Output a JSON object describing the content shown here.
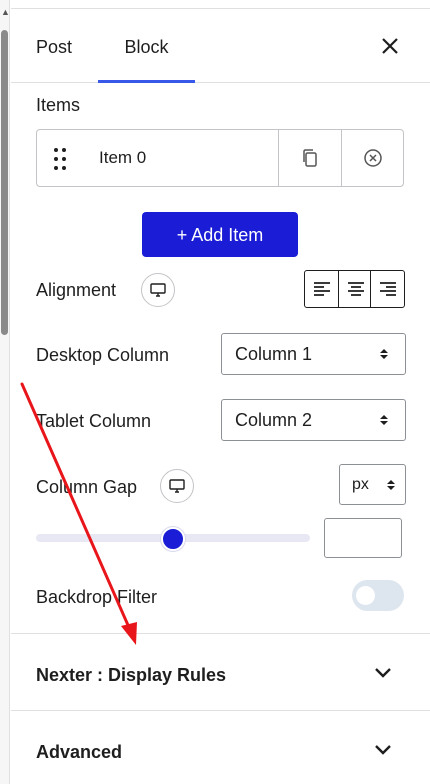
{
  "tabs": [
    {
      "label": "Post",
      "active": false
    },
    {
      "label": "Block",
      "active": true
    }
  ],
  "items_section": {
    "title": "Items",
    "items": [
      {
        "label": "Item 0"
      }
    ],
    "add_label": "+ Add Item"
  },
  "alignment": {
    "label": "Alignment",
    "device_icon": "desktop-icon",
    "options": [
      "align-left-icon",
      "align-center-icon",
      "align-right-icon"
    ]
  },
  "desktop_column": {
    "label": "Desktop Column",
    "value": "Column 1"
  },
  "tablet_column": {
    "label": "Tablet Column",
    "value": "Column 2"
  },
  "column_gap": {
    "label": "Column Gap",
    "unit": "px",
    "value": "",
    "slider_position": 0.5
  },
  "backdrop_filter": {
    "label": "Backdrop Filter",
    "enabled": false
  },
  "sections": [
    {
      "title": "Nexter : Display Rules"
    },
    {
      "title": "Advanced"
    }
  ],
  "colors": {
    "accent": "#3858e9",
    "primary_button": "#1a1cd6",
    "annotation_arrow": "#e8161b"
  }
}
